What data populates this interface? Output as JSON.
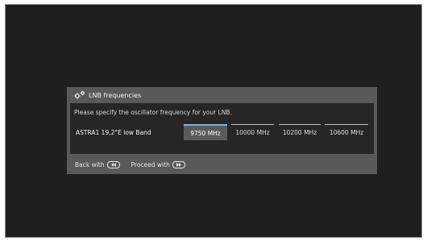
{
  "dialog": {
    "title": "LNB frequencies",
    "icon": "gears-icon",
    "prompt": "Please specify the oscillator frequency for your LNB.",
    "satellite_label": "ASTRA1 19,2°E low Band",
    "frequencies": [
      {
        "label": "9750 MHz",
        "selected": true
      },
      {
        "label": "10000 MHz",
        "selected": false
      },
      {
        "label": "10200 MHz",
        "selected": false
      },
      {
        "label": "10600 MHz",
        "selected": false
      }
    ],
    "footer": {
      "back_label": "Back with",
      "back_icon": "rewind-key-icon",
      "proceed_label": "Proceed with",
      "proceed_icon": "forward-key-icon"
    }
  },
  "colors": {
    "background": "#1f1f1f",
    "dialog": "#595959",
    "panel": "#262626",
    "accent": "#7fb1da"
  }
}
